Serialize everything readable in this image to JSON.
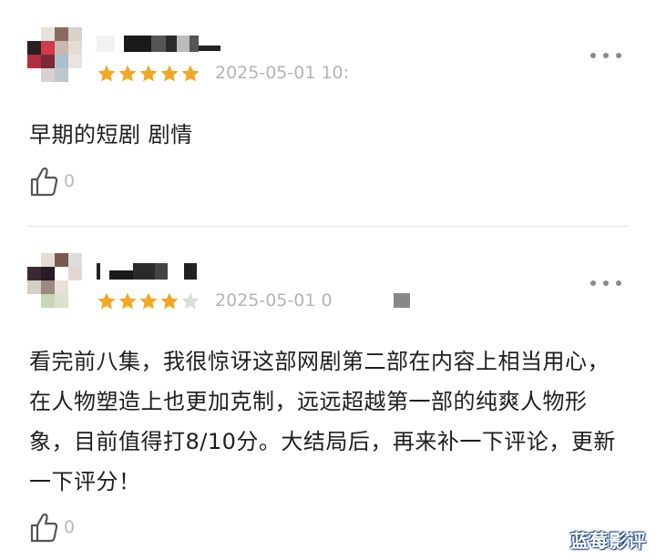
{
  "reviews": [
    {
      "date": "2025-05-01 10:",
      "rating": 5,
      "content": "早期的短剧 剧情",
      "likes": "0"
    },
    {
      "date": "2025-05-01 0",
      "rating": 4,
      "content": "看完前八集，我很惊讶这部网剧第二部在内容上相当用心，在人物塑造上也更加克制，远远超越第一部的纯爽人物形象，目前值得打8/10分。大结局后，再来补一下评论，更新一下评分！",
      "likes": "0"
    }
  ],
  "watermark": "蓝莓影评",
  "colors": {
    "star_filled": "#f5a623",
    "star_empty": "#dcdcdc",
    "meta_text": "#b4b4b4"
  },
  "icons": [
    "more-icon",
    "thumbs-up-icon",
    "star-icon"
  ]
}
